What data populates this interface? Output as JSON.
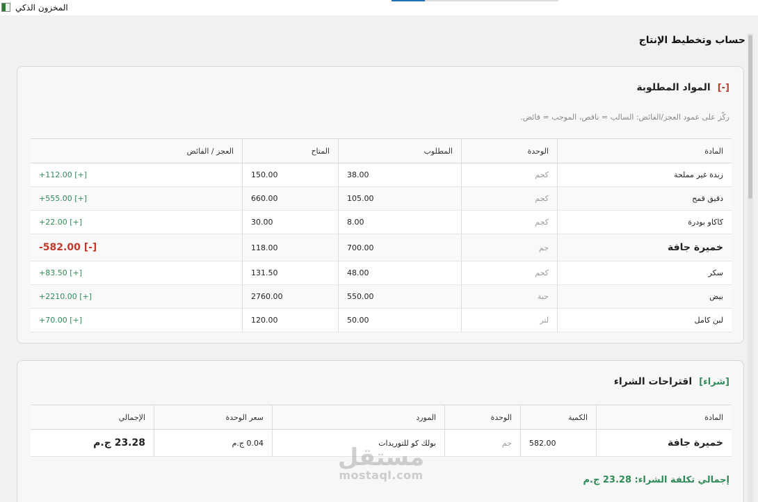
{
  "window": {
    "title": "المخزون الذكي"
  },
  "page": {
    "title": "حساب وتخطيط الإنتاج"
  },
  "materials": {
    "tag": "[-]",
    "title": "المواد المطلوبة",
    "hint": "ركّز على عمود العجز/الفائض: السالب = ناقص، الموجب = فائض.",
    "columns": [
      "المادة",
      "الوحدة",
      "المطلوب",
      "المتاح",
      "العجز / الفائض"
    ],
    "rows": [
      {
        "name": "زبدة غير مملحة",
        "unit": "كجم",
        "required": "38.00",
        "available": "150.00",
        "diff": "+112.00 [+]",
        "status": "surplus"
      },
      {
        "name": "دقيق قمح",
        "unit": "كجم",
        "required": "105.00",
        "available": "660.00",
        "diff": "+555.00 [+]",
        "status": "surplus"
      },
      {
        "name": "كاكاو بودرة",
        "unit": "كجم",
        "required": "8.00",
        "available": "30.00",
        "diff": "+22.00 [+]",
        "status": "surplus"
      },
      {
        "name": "خميرة جافة",
        "unit": "جم",
        "required": "700.00",
        "available": "118.00",
        "diff": "-582.00 [-]",
        "status": "shortage"
      },
      {
        "name": "سكر",
        "unit": "كجم",
        "required": "48.00",
        "available": "131.50",
        "diff": "+83.50 [+]",
        "status": "surplus"
      },
      {
        "name": "بيض",
        "unit": "حبة",
        "required": "550.00",
        "available": "2760.00",
        "diff": "+2210.00 [+]",
        "status": "surplus"
      },
      {
        "name": "لبن كامل",
        "unit": "لتر",
        "required": "50.00",
        "available": "120.00",
        "diff": "+70.00 [+]",
        "status": "surplus"
      }
    ]
  },
  "purchase": {
    "tag": "[شراء]",
    "title": "اقتراحات الشراء",
    "columns": [
      "المادة",
      "الكمية",
      "الوحدة",
      "المورد",
      "سعر الوحدة",
      "الإجمالي"
    ],
    "rows": [
      {
        "name": "خميرة جافة",
        "qty": "582.00",
        "unit": "جم",
        "supplier": "بولك كو للتوريدات",
        "unit_price": "0.04 ج.م",
        "total": "23.28 ج.م"
      }
    ],
    "total_line": "إجمالي تكلفة الشراء: 23.28 ج.م"
  },
  "watermark": {
    "arabic": "مستقل",
    "latin": "mostaql.com"
  },
  "colors": {
    "surplus": "#2e8b57",
    "shortage": "#c0392b",
    "accent": "#1e6fb8"
  }
}
